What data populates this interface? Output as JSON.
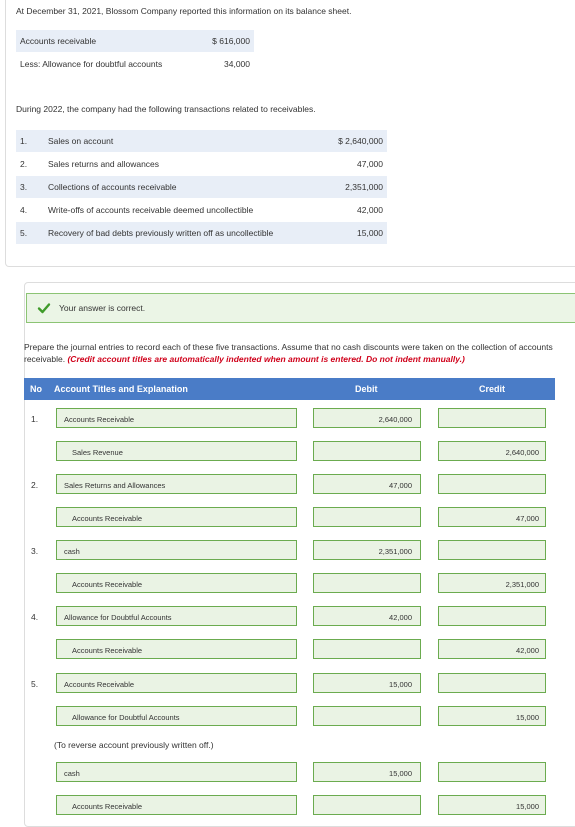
{
  "intro": "At December 31, 2021, Blossom Company reported this information on its balance sheet.",
  "balance_sheet": [
    {
      "label": "Accounts receivable",
      "value": "$ 616,000"
    },
    {
      "label": "Less: Allowance for doubtful accounts",
      "value": "34,000"
    }
  ],
  "during": "During 2022, the company had the following transactions related to receivables.",
  "transactions": [
    {
      "num": "1.",
      "desc": "Sales on account",
      "amount": "$ 2,640,000"
    },
    {
      "num": "2.",
      "desc": "Sales returns and allowances",
      "amount": "47,000"
    },
    {
      "num": "3.",
      "desc": "Collections of accounts receivable",
      "amount": "2,351,000"
    },
    {
      "num": "4.",
      "desc": "Write-offs of accounts receivable deemed uncollectible",
      "amount": "42,000"
    },
    {
      "num": "5.",
      "desc": "Recovery of bad debts previously written off as uncollectible",
      "amount": "15,000"
    }
  ],
  "status": "Your answer is correct.",
  "instructions": {
    "main": "Prepare the journal entries to record each of these five transactions. Assume that no cash discounts were taken on the collection of accounts receivable. ",
    "note": "(Credit account titles are automatically indented when amount is entered. Do not indent manually.)"
  },
  "table_header": {
    "no": "No",
    "account": "Account Titles and Explanation",
    "debit": "Debit",
    "credit": "Credit"
  },
  "entries": [
    {
      "no": "1.",
      "title": "Accounts Receivable",
      "debit": "2,640,000",
      "credit": ""
    },
    {
      "no": "",
      "title": "Sales Revenue",
      "debit": "",
      "credit": "2,640,000"
    },
    {
      "no": "2.",
      "title": "Sales Returns and Allowances",
      "debit": "47,000",
      "credit": ""
    },
    {
      "no": "",
      "title": "Accounts Receivable",
      "debit": "",
      "credit": "47,000"
    },
    {
      "no": "3.",
      "title": "cash",
      "debit": "2,351,000",
      "credit": ""
    },
    {
      "no": "",
      "title": "Accounts Receivable",
      "debit": "",
      "credit": "2,351,000"
    },
    {
      "no": "4.",
      "title": "Allowance for Doubtful Accounts",
      "debit": "42,000",
      "credit": ""
    },
    {
      "no": "",
      "title": "Accounts Receivable",
      "debit": "",
      "credit": "42,000"
    },
    {
      "no": "5.",
      "title": "Accounts Receivable",
      "debit": "15,000",
      "credit": ""
    },
    {
      "no": "",
      "title": "Allowance for Doubtful Accounts",
      "debit": "",
      "credit": "15,000"
    },
    {
      "no": "",
      "title": "cash",
      "debit": "15,000",
      "credit": ""
    },
    {
      "no": "",
      "title": "Accounts Receivable",
      "debit": "",
      "credit": "15,000"
    }
  ],
  "explanation_note": "(To reverse account previously written off.)",
  "colors": {
    "header": "#4a7cc7",
    "correct_bg": "#ebf5e6",
    "field_border": "#6bab4f",
    "required_note": "#d0021b"
  }
}
